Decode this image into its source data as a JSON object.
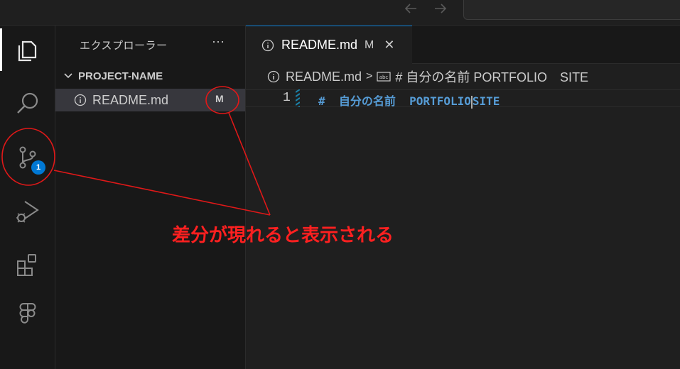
{
  "titlebar": {
    "back_icon": "arrow-left-icon",
    "forward_icon": "arrow-right-icon"
  },
  "activity_bar": {
    "items": [
      "explorer-icon",
      "search-icon",
      "source-control-icon",
      "run-debug-icon",
      "extensions-icon",
      "figma-icon"
    ],
    "source_control_badge": "1"
  },
  "sidebar": {
    "title": "エクスプローラー",
    "more": "···",
    "section": "PROJECT-NAME",
    "file": {
      "name": "README.md",
      "status": "M"
    }
  },
  "editor": {
    "tab": {
      "name": "README.md",
      "status": "M",
      "close": "✕"
    },
    "breadcrumb": {
      "file": "README.md",
      "separator": ">",
      "symbol": "# 自分の名前 PORTFOLIO　SITE"
    },
    "line_number": "1",
    "code_before_cursor": "#  自分の名前  PORTFOLIO",
    "code_after_cursor": "SITE"
  },
  "annotation": {
    "text": "差分が現れると表示される",
    "color": "#ff2020"
  },
  "colors": {
    "accent": "#0078d4",
    "heading": "#569cd6",
    "badge": "#0078d4"
  }
}
